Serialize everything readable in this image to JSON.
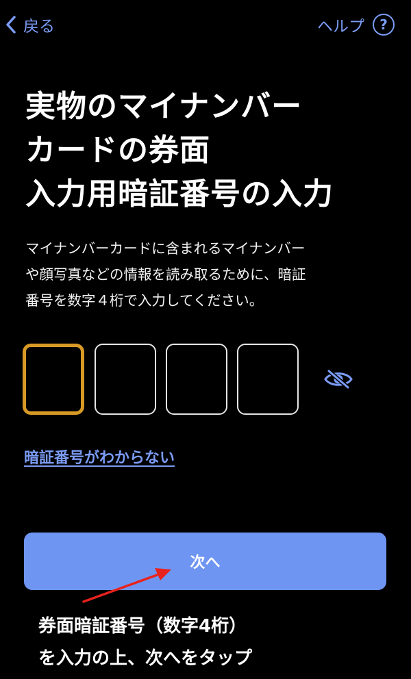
{
  "nav": {
    "back_label": "戻る",
    "help_label": "ヘルプ",
    "help_icon_glyph": "?"
  },
  "title": {
    "lines": [
      "実物のマイナンバー",
      "カードの券面",
      "入力用暗証番号の入力"
    ]
  },
  "description": {
    "lines": [
      "マイナンバーカードに含まれるマイナンバー",
      "や顔写真などの情報を読み取るために、暗証",
      "番号を数字４桁で入力してください。"
    ]
  },
  "pin": {
    "digits": [
      "",
      "",
      "",
      ""
    ],
    "focused_index": 0
  },
  "forgot_link": "暗証番号がわからない",
  "next_button": "次へ",
  "annotation": {
    "lines": [
      "券面暗証番号（数字4桁）",
      "を入力の上、次へをタップ"
    ]
  },
  "icons": {
    "back": "chevron-left-icon",
    "help": "question-circle-icon",
    "toggle": "eye-slash-icon"
  },
  "colors": {
    "background": "#000000",
    "accent": "#7b9cf5",
    "button": "#6f95f2",
    "focus_border": "#d79a25",
    "annotation_arrow": "#e8221c"
  }
}
